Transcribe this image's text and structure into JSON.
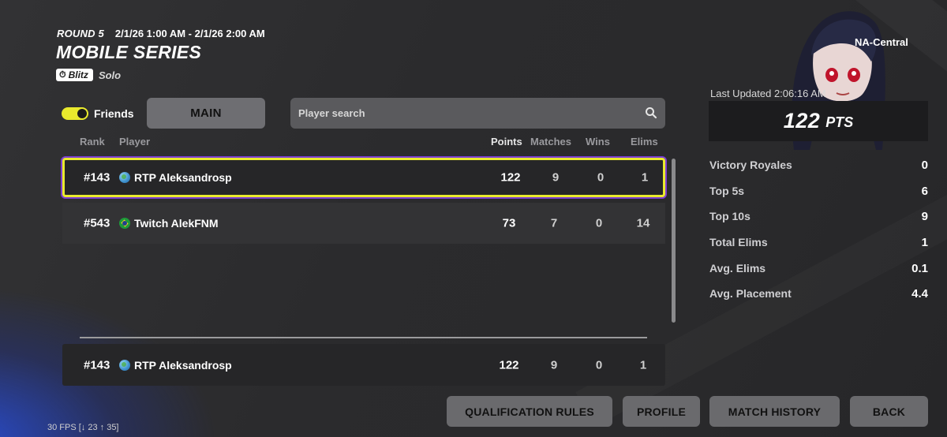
{
  "header": {
    "round": "ROUND 5",
    "time_range": "2/1/26 1:00 AM - 2/1/26 2:00 AM",
    "title": "MOBILE SERIES",
    "badge": "Blitz",
    "mode": "Solo"
  },
  "controls": {
    "friends_label": "Friends",
    "friends_on": true,
    "main_tab": "MAIN",
    "search_placeholder": "Player search"
  },
  "table": {
    "headers": {
      "rank": "Rank",
      "player": "Player",
      "points": "Points",
      "matches": "Matches",
      "wins": "Wins",
      "elims": "Elims"
    },
    "rows": [
      {
        "rank": "#143",
        "flag": "globe-icon",
        "player": "RTP Aleksandrosp",
        "points": "122",
        "matches": "9",
        "wins": "0",
        "elims": "1"
      },
      {
        "rank": "#543",
        "flag": "brazil-flag-icon",
        "player": "Twitch AlekFNM",
        "points": "73",
        "matches": "7",
        "wins": "0",
        "elims": "14"
      }
    ],
    "my_row": {
      "rank": "#143",
      "flag": "globe-icon",
      "player": "RTP Aleksandrosp",
      "points": "122",
      "matches": "9",
      "wins": "0",
      "elims": "1"
    }
  },
  "panel": {
    "region": "NA-Central",
    "last_updated": "Last Updated 2:06:16 AM",
    "points": "122",
    "points_unit": "PTS",
    "stats": [
      {
        "label": "Victory Royales",
        "value": "0"
      },
      {
        "label": "Top 5s",
        "value": "6"
      },
      {
        "label": "Top 10s",
        "value": "9"
      },
      {
        "label": "Total Elims",
        "value": "1"
      },
      {
        "label": "Avg. Elims",
        "value": "0.1"
      },
      {
        "label": "Avg. Placement",
        "value": "4.4"
      }
    ]
  },
  "buttons": {
    "qualification": "QUALIFICATION RULES",
    "profile": "PROFILE",
    "match_history": "MATCH HISTORY",
    "back": "BACK"
  },
  "fps_overlay": "30 FPS [↓ 23 ↑ 35]",
  "colors": {
    "accent_yellow": "#e9ea2d",
    "selection_glow": "#7b3fd1",
    "button_gray": "#6a6a6d"
  }
}
